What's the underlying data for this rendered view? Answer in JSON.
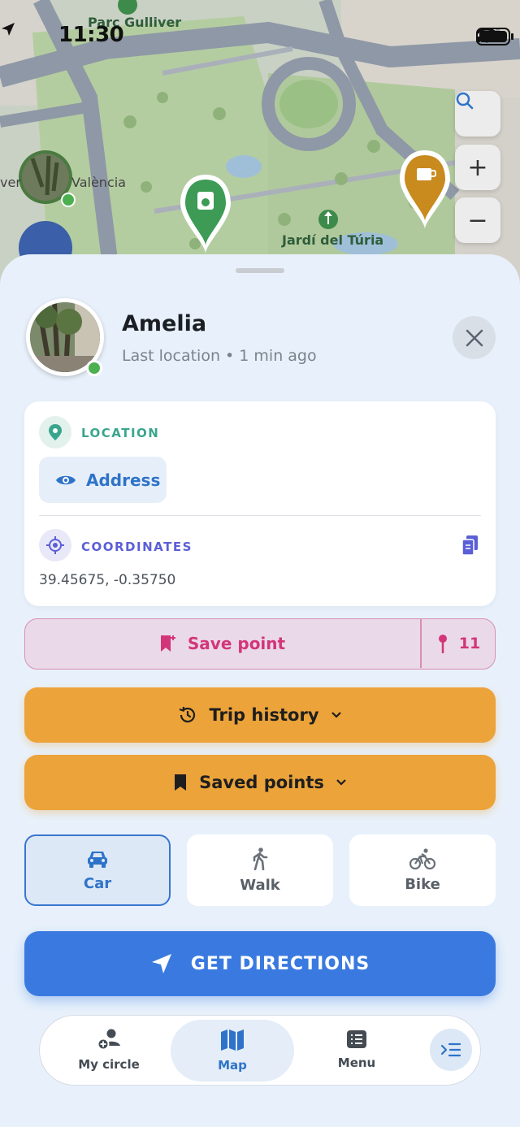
{
  "status_bar": {
    "time": "11:30"
  },
  "map": {
    "labels": {
      "park_top": "Parc Gulliver",
      "city": "València",
      "park_bottom": "Jardí del Túria"
    },
    "controls": {
      "search": "search-icon",
      "zoom_in": "+",
      "zoom_out": "−"
    }
  },
  "profile": {
    "name": "Amelia",
    "subtitle": "Last location • 1 min ago",
    "online": true
  },
  "location": {
    "label": "LOCATION",
    "address_button": "Address",
    "coordinates_label": "COORDINATES",
    "coordinates": "39.45675, -0.35750"
  },
  "save_point": {
    "label": "Save point",
    "count": "11"
  },
  "trip_history": {
    "label": "Trip history"
  },
  "saved_points": {
    "label": "Saved points"
  },
  "modes": [
    {
      "label": "Car",
      "icon": "car-icon",
      "selected": true
    },
    {
      "label": "Walk",
      "icon": "walk-icon",
      "selected": false
    },
    {
      "label": "Bike",
      "icon": "bike-icon",
      "selected": false
    }
  ],
  "directions": {
    "label": "GET DIRECTIONS"
  },
  "nav": [
    {
      "label": "My circle",
      "icon": "add-person-icon",
      "active": false
    },
    {
      "label": "Map",
      "icon": "map-icon",
      "active": true
    },
    {
      "label": "Menu",
      "icon": "list-icon",
      "active": false
    }
  ],
  "colors": {
    "primary": "#3a7ae0",
    "accent_orange": "#eba33a",
    "save_pink": "#d2357a",
    "location_green": "#3aa58d",
    "coords_purple": "#5b5fd6",
    "online_green": "#4caf50"
  }
}
